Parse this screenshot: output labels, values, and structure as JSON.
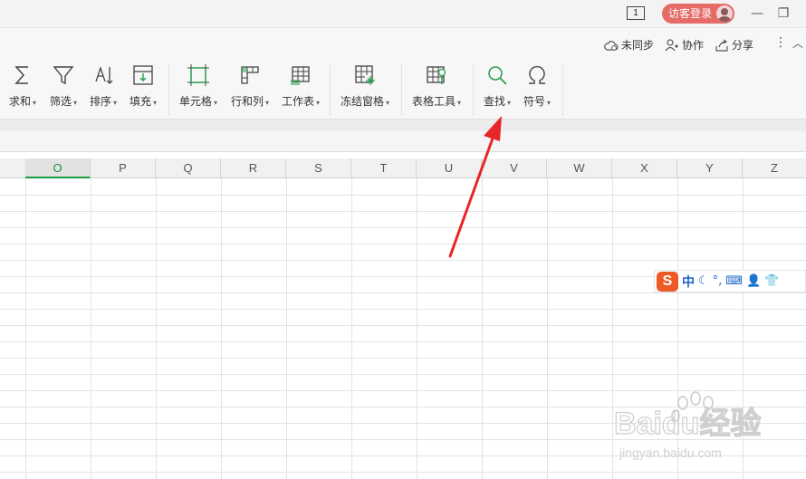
{
  "titlebar": {
    "page_indicator": "1",
    "login_label": "访客登录",
    "minimize": "—",
    "restore": "❐",
    "close": "×"
  },
  "subbar": {
    "sync_label": "未同步",
    "collab_label": "协作",
    "share_label": "分享"
  },
  "ribbon": {
    "buttons": [
      {
        "label": "求和",
        "icon": "sigma-icon"
      },
      {
        "label": "筛选",
        "icon": "filter-icon"
      },
      {
        "label": "排序",
        "icon": "sort-icon"
      },
      {
        "label": "填充",
        "icon": "fill-icon"
      },
      {
        "label": "单元格",
        "icon": "cell-icon"
      },
      {
        "label": "行和列",
        "icon": "row-col-icon"
      },
      {
        "label": "工作表",
        "icon": "worksheet-icon"
      },
      {
        "label": "冻结窗格",
        "icon": "freeze-panes-icon"
      },
      {
        "label": "表格工具",
        "icon": "table-tools-icon"
      },
      {
        "label": "查找",
        "icon": "search-icon"
      },
      {
        "label": "符号",
        "icon": "omega-icon"
      }
    ]
  },
  "columns": [
    "O",
    "P",
    "Q",
    "R",
    "S",
    "T",
    "U",
    "V",
    "W",
    "X",
    "Y",
    "Z"
  ],
  "active_column": "O",
  "ime": {
    "logo": "S",
    "mode": "中"
  },
  "watermark": {
    "brand": "Baidu经验",
    "url": "jingyan.baidu.com"
  },
  "colors": {
    "accent_green": "#1e9e44",
    "login_red": "#e56b67",
    "arrow_red": "#e8262a"
  }
}
